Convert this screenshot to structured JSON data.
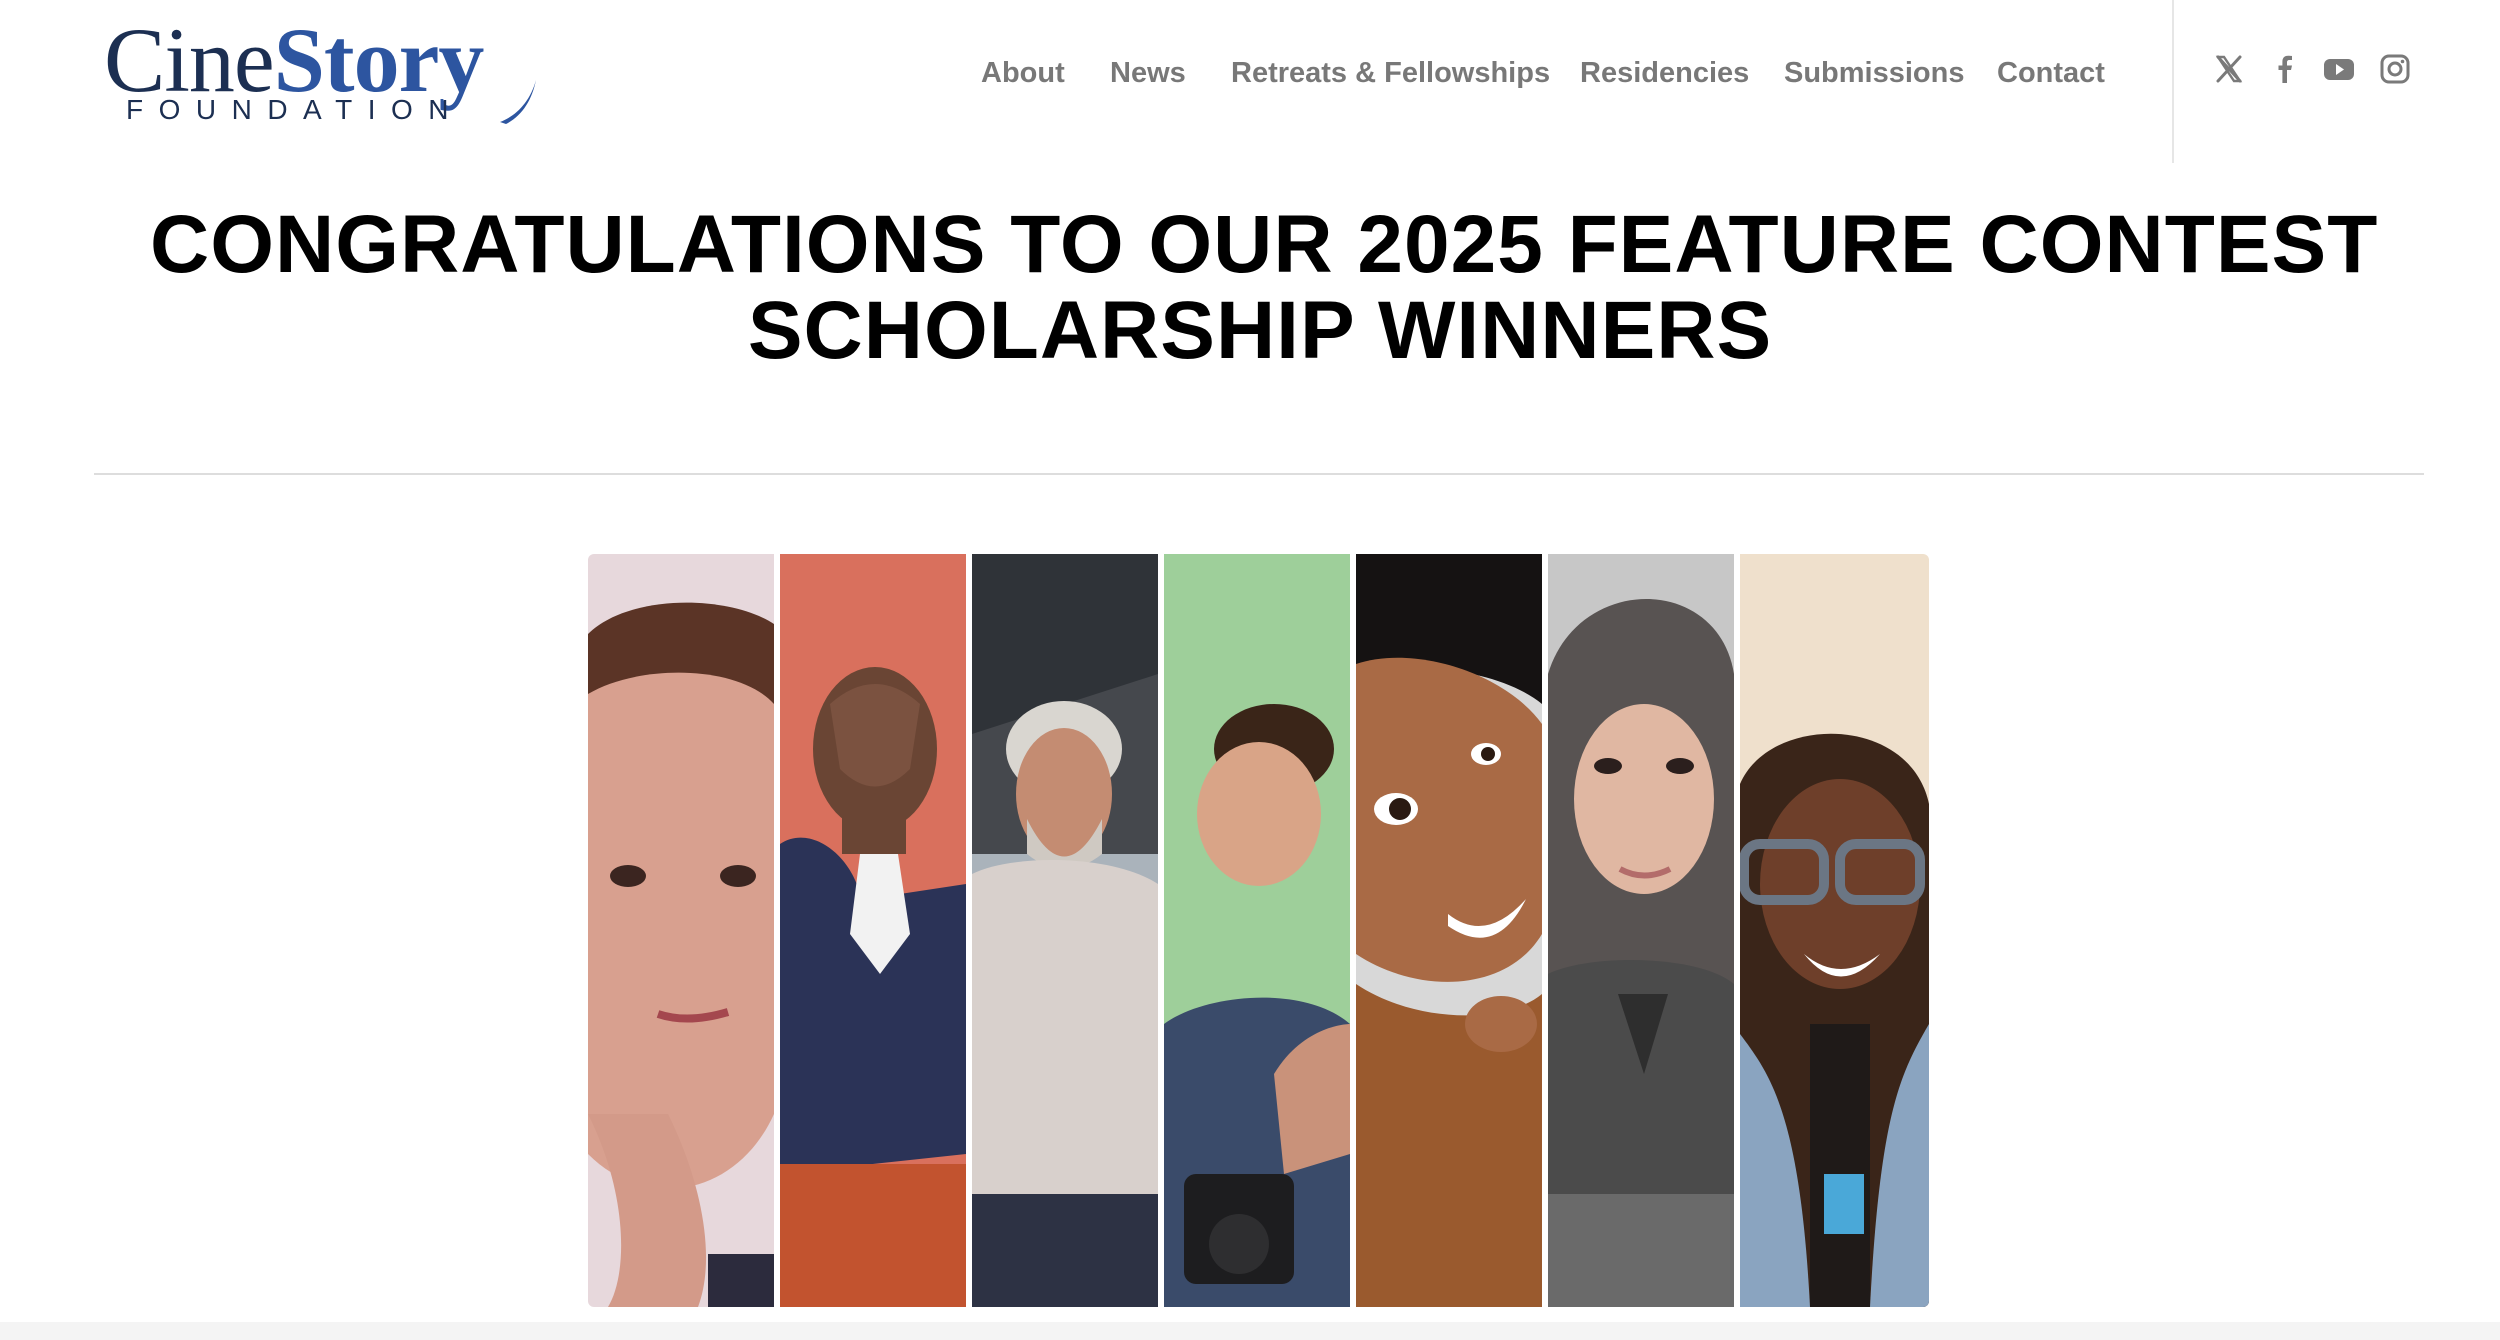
{
  "logo": {
    "brand_part1": "Cine",
    "brand_part2": "Story",
    "subtitle": "FOUNDATION"
  },
  "nav": {
    "items": [
      {
        "label": "About"
      },
      {
        "label": "News"
      },
      {
        "label": "Retreats & Fellowships"
      },
      {
        "label": "Residencies"
      },
      {
        "label": "Submissions"
      },
      {
        "label": "Contact"
      }
    ]
  },
  "social": [
    {
      "icon": "x-twitter-icon"
    },
    {
      "icon": "facebook-icon"
    },
    {
      "icon": "youtube-icon"
    },
    {
      "icon": "instagram-icon"
    }
  ],
  "page": {
    "title_line1": "CONGRATULATIONS TO OUR 2025 FEATURE CONTEST",
    "title_line2": "SCHOLARSHIP WINNERS"
  },
  "collage": {
    "panels": [
      {
        "icon": "winner-portrait-1",
        "background": "#e7d8dc"
      },
      {
        "icon": "winner-portrait-2",
        "background": "#d9705d"
      },
      {
        "icon": "winner-portrait-3",
        "background": "#45484d"
      },
      {
        "icon": "winner-portrait-4",
        "background": "#9ecf9a"
      },
      {
        "icon": "winner-portrait-5",
        "background": "#d8d8d8"
      },
      {
        "icon": "winner-portrait-6",
        "background": "#b0b0b0"
      },
      {
        "icon": "winner-portrait-7",
        "background": "#efe0cc"
      }
    ]
  },
  "colors": {
    "brand_dark": "#1c2f52",
    "brand_blue": "#2d55a0",
    "nav_text": "#787878",
    "title_text": "#000000"
  }
}
